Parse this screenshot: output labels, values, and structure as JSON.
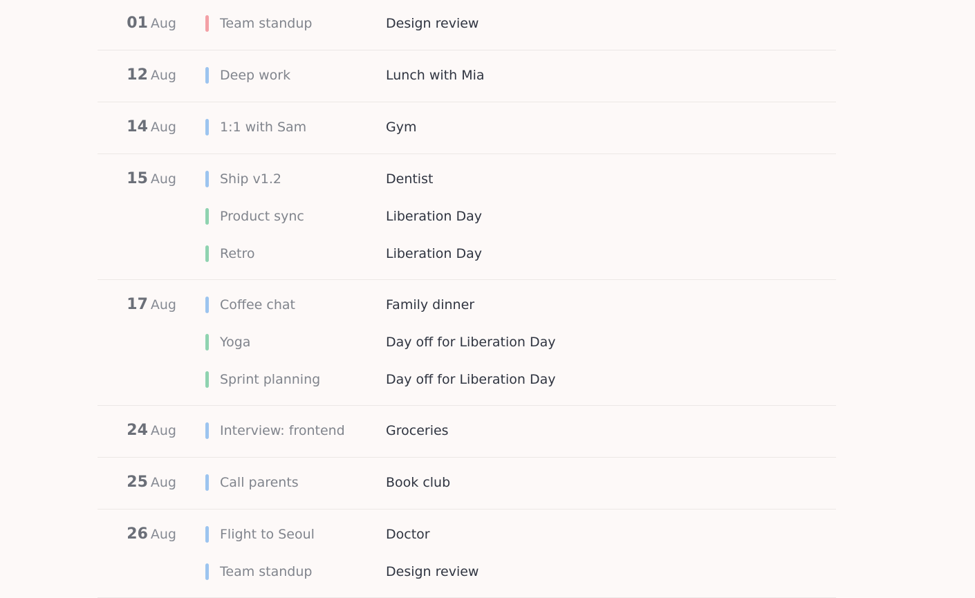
{
  "colors": {
    "background": "#fdf9f8",
    "divider": "#ece8e6",
    "pink": "#f3a0a6",
    "blue": "#9cc4ef",
    "green": "#8fd3b0"
  },
  "days": [
    {
      "day": "01",
      "month": "Aug",
      "events": [
        {
          "title": "Team standup",
          "note": "Design review",
          "color": "pink"
        }
      ]
    },
    {
      "day": "12",
      "month": "Aug",
      "events": [
        {
          "title": "Deep work",
          "note": "Lunch with Mia",
          "color": "blue"
        }
      ]
    },
    {
      "day": "14",
      "month": "Aug",
      "events": [
        {
          "title": "1:1 with Sam",
          "note": "Gym",
          "color": "blue"
        }
      ]
    },
    {
      "day": "15",
      "month": "Aug",
      "events": [
        {
          "title": "Ship v1.2",
          "note": "Dentist",
          "color": "blue"
        },
        {
          "title": "Product sync",
          "note": "Liberation Day",
          "color": "green"
        },
        {
          "title": "Retro",
          "note": "Liberation Day",
          "color": "green"
        }
      ]
    },
    {
      "day": "17",
      "month": "Aug",
      "events": [
        {
          "title": "Coffee chat",
          "note": "Family dinner",
          "color": "blue"
        },
        {
          "title": "Yoga",
          "note": "Day off for Liberation Day",
          "color": "green"
        },
        {
          "title": "Sprint planning",
          "note": "Day off for Liberation Day",
          "color": "green"
        }
      ]
    },
    {
      "day": "24",
      "month": "Aug",
      "events": [
        {
          "title": "Interview: frontend",
          "note": "Groceries",
          "color": "blue"
        }
      ]
    },
    {
      "day": "25",
      "month": "Aug",
      "events": [
        {
          "title": "Call parents",
          "note": "Book club",
          "color": "blue"
        }
      ]
    },
    {
      "day": "26",
      "month": "Aug",
      "events": [
        {
          "title": "Flight to Seoul",
          "note": "Doctor",
          "color": "blue"
        },
        {
          "title": "Team standup",
          "note": "Design review",
          "color": "blue"
        }
      ]
    }
  ]
}
